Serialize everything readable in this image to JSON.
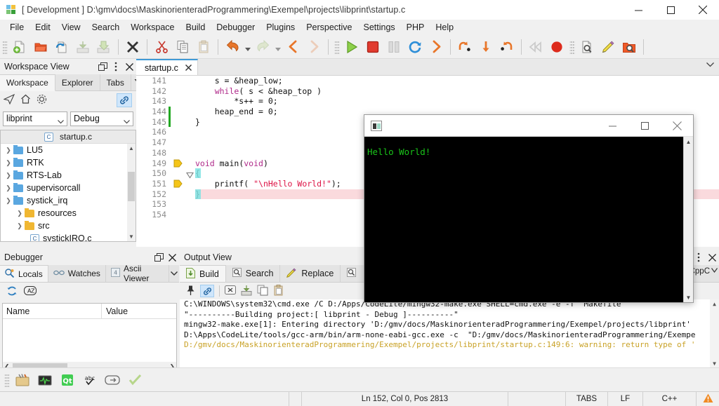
{
  "window": {
    "title": "[ Development ] D:\\gmv\\docs\\MaskinorienteradProgrammering\\Exempel\\projects\\libprint\\startup.c",
    "logo": "codelite-logo-icon",
    "controls": [
      {
        "name": "minimize-button",
        "glyph": "minimize-icon"
      },
      {
        "name": "maximize-button",
        "glyph": "maximize-icon"
      },
      {
        "name": "close-button",
        "glyph": "close-icon"
      }
    ]
  },
  "menubar": {
    "items": [
      "File",
      "Edit",
      "View",
      "Search",
      "Workspace",
      "Build",
      "Debugger",
      "Plugins",
      "Perspective",
      "Settings",
      "PHP",
      "Help"
    ]
  },
  "toolbar": {
    "groups": [
      {
        "buttons": [
          {
            "name": "new-file-button",
            "icon": "new-file-icon",
            "title": "New"
          },
          {
            "name": "open-file-button",
            "icon": "open-folder-icon",
            "title": "Open"
          },
          {
            "name": "reload-file-button",
            "icon": "reload-file-icon",
            "title": "Reload"
          },
          {
            "name": "save-file-button",
            "icon": "save-icon",
            "title": "Save",
            "disabled": true
          },
          {
            "name": "save-all-button",
            "icon": "save-all-icon",
            "title": "Save All",
            "disabled": true
          }
        ]
      },
      {
        "buttons": [
          {
            "name": "close-file-button",
            "icon": "close-x-icon",
            "title": "Close"
          }
        ]
      },
      {
        "buttons": [
          {
            "name": "cut-button",
            "icon": "scissors-icon",
            "title": "Cut"
          },
          {
            "name": "copy-button",
            "icon": "copy-icon",
            "title": "Copy"
          },
          {
            "name": "paste-button",
            "icon": "paste-icon",
            "title": "Paste",
            "disabled": true
          }
        ]
      },
      {
        "buttons": [
          {
            "name": "undo-button",
            "icon": "undo-arrow-icon",
            "title": "Undo",
            "dropdown": true
          },
          {
            "name": "redo-button",
            "icon": "redo-arrow-icon",
            "title": "Redo",
            "dropdown": true,
            "disabled": true
          },
          {
            "name": "back-button",
            "icon": "chevron-left-icon",
            "title": "Back"
          },
          {
            "name": "forward-button",
            "icon": "chevron-right-icon",
            "title": "Forward",
            "disabled": true
          }
        ]
      },
      {
        "buttons": [
          {
            "name": "start-debug-button",
            "icon": "play-triangle-icon",
            "title": "Start / Continue"
          },
          {
            "name": "stop-debug-button",
            "icon": "stop-square-icon",
            "title": "Stop"
          },
          {
            "name": "pause-debug-button",
            "icon": "pause-bars-icon",
            "title": "Pause",
            "disabled": true
          },
          {
            "name": "restart-debug-button",
            "icon": "restart-circular-arrow-icon",
            "title": "Restart"
          },
          {
            "name": "run-to-cursor-button",
            "icon": "chevron-right-orange-icon",
            "title": "Run to cursor"
          }
        ]
      },
      {
        "buttons": [
          {
            "name": "step-over-button",
            "icon": "step-over-icon",
            "title": "Step Over"
          },
          {
            "name": "step-into-button",
            "icon": "step-into-arrow-down-icon",
            "title": "Step Into"
          },
          {
            "name": "step-out-button",
            "icon": "step-out-icon",
            "title": "Step Out"
          }
        ]
      },
      {
        "buttons": [
          {
            "name": "rewind-button",
            "icon": "rewind-icon",
            "title": "Rewind",
            "disabled": true
          },
          {
            "name": "record-button",
            "icon": "record-circle-icon",
            "title": "Record"
          }
        ]
      },
      {
        "buttons": [
          {
            "name": "find-in-file-button",
            "icon": "find-document-icon",
            "title": "Find"
          },
          {
            "name": "replace-button",
            "icon": "pencil-icon",
            "title": "Replace"
          },
          {
            "name": "find-in-files-button",
            "icon": "find-in-files-icon",
            "title": "Find In Files"
          }
        ]
      }
    ]
  },
  "workspace_panel": {
    "title": "Workspace View",
    "head_tools": [
      {
        "name": "float-panel-button",
        "icon": "float-window-icon"
      },
      {
        "name": "panel-menu-button",
        "icon": "vertical-dots-icon"
      },
      {
        "name": "close-panel-button",
        "icon": "close-icon"
      }
    ],
    "tabs": [
      {
        "name": "tab-workspace",
        "label": "Workspace",
        "selected": true
      },
      {
        "name": "tab-explorer",
        "label": "Explorer",
        "selected": false
      },
      {
        "name": "tab-tabs",
        "label": "Tabs",
        "selected": false
      }
    ],
    "tabs_overflow_icon": "filter-funnel-icon",
    "tools": [
      {
        "name": "collapse-all-button",
        "icon": "paper-plane-icon"
      },
      {
        "name": "home-button",
        "icon": "home-icon"
      },
      {
        "name": "settings-button",
        "icon": "gear-icon"
      }
    ],
    "link_button": {
      "name": "link-editor-button",
      "icon": "link-chain-icon",
      "active": true
    },
    "selects": [
      {
        "name": "project-select",
        "value": "libprint"
      },
      {
        "name": "configuration-select",
        "value": "Debug"
      }
    ],
    "tree_header": {
      "name": "active-file-header",
      "label": "startup.c",
      "icon": "c-file-icon"
    },
    "tree": [
      {
        "label": "LU5",
        "icon": "folder-blue-icon",
        "expanded": false,
        "depth": 0
      },
      {
        "label": "RTK",
        "icon": "folder-blue-icon",
        "expanded": false,
        "depth": 0
      },
      {
        "label": "RTS-Lab",
        "icon": "folder-blue-icon",
        "expanded": false,
        "depth": 0
      },
      {
        "label": "supervisorcall",
        "icon": "folder-blue-icon",
        "expanded": false,
        "depth": 0
      },
      {
        "label": "systick_irq",
        "icon": "folder-blue-icon",
        "expanded": true,
        "depth": 0
      },
      {
        "label": "resources",
        "icon": "folder-yellow-icon",
        "expanded": false,
        "depth": 1
      },
      {
        "label": "src",
        "icon": "folder-yellow-icon",
        "expanded": true,
        "depth": 1
      },
      {
        "label": "systickIRQ.c",
        "icon": "c-file-icon",
        "expanded": null,
        "depth": 2
      }
    ]
  },
  "editor": {
    "tab": {
      "name": "editor-tab-startup-c",
      "label": "startup.c",
      "close_icon": "close-icon"
    },
    "overflow_icon": "chevron-down-icon",
    "first_line_number": 141,
    "lines": [
      {
        "n": 141,
        "text": "    s = &heap_low;",
        "marker": null,
        "highlight": false
      },
      {
        "n": 142,
        "text": "    while( s < &heap_top )",
        "marker": null,
        "highlight": false
      },
      {
        "n": 143,
        "text": "        *s++ = 0;",
        "marker": null,
        "highlight": false
      },
      {
        "n": 144,
        "text": "    heap_end = 0;",
        "marker": null,
        "highlight": false
      },
      {
        "n": 145,
        "text": "}",
        "marker": null,
        "highlight": false
      },
      {
        "n": 146,
        "text": "",
        "marker": null,
        "highlight": false
      },
      {
        "n": 147,
        "text": "",
        "marker": null,
        "highlight": false
      },
      {
        "n": 148,
        "text": "",
        "marker": null,
        "highlight": false
      },
      {
        "n": 149,
        "text": "void main(void)",
        "marker": "bookmark-arrow-icon",
        "highlight": false
      },
      {
        "n": 150,
        "text": "{",
        "marker": null,
        "highlight": false,
        "fold": true,
        "brace": true
      },
      {
        "n": 151,
        "text": "    printf( \"\\nHello World!\");",
        "marker": "bookmark-arrow-icon",
        "highlight": false
      },
      {
        "n": 152,
        "text": "}",
        "marker": null,
        "highlight": true,
        "brace": true
      },
      {
        "n": 153,
        "text": "",
        "marker": null,
        "highlight": false
      },
      {
        "n": 154,
        "text": "",
        "marker": null,
        "highlight": false
      }
    ]
  },
  "debugger_panel": {
    "title": "Debugger",
    "head_tools": [
      {
        "name": "float-panel-button",
        "icon": "float-window-icon"
      },
      {
        "name": "close-panel-button",
        "icon": "close-icon"
      }
    ],
    "tabs": [
      {
        "name": "tab-locals",
        "label": "Locals",
        "icon": "locals-icon",
        "selected": true
      },
      {
        "name": "tab-watches",
        "label": "Watches",
        "icon": "watches-glasses-icon",
        "selected": false
      },
      {
        "name": "tab-ascii-viewer",
        "label": "Ascii Viewer",
        "icon": "ascii-viewer-icon",
        "selected": false
      }
    ],
    "tabs_overflow_icon": "chevron-down-icon",
    "tools": [
      {
        "name": "refresh-button",
        "icon": "refresh-arrows-icon"
      },
      {
        "name": "sort-button",
        "icon": "az-sort-icon"
      }
    ],
    "columns": [
      "Name",
      "Value"
    ],
    "rows": []
  },
  "output_panel": {
    "title": "Output View",
    "head_tools": [
      {
        "name": "float-panel-button",
        "icon": "float-window-icon"
      },
      {
        "name": "panel-menu-button",
        "icon": "vertical-dots-icon"
      },
      {
        "name": "close-panel-button",
        "icon": "close-icon"
      }
    ],
    "tabs": [
      {
        "name": "tab-build",
        "label": "Build",
        "icon": "build-page-icon",
        "selected": true
      },
      {
        "name": "tab-search",
        "label": "Search",
        "icon": "search-magnifier-icon",
        "selected": false
      },
      {
        "name": "tab-replace",
        "label": "Replace",
        "icon": "pencil-icon",
        "selected": false
      },
      {
        "name": "tab-references",
        "label": "",
        "icon": "search-magnifier-icon",
        "selected": false
      }
    ],
    "tools": [
      {
        "name": "pin-button",
        "icon": "pin-icon"
      },
      {
        "name": "link-button",
        "icon": "link-chain-icon",
        "active": true
      },
      {
        "name": "clear-button",
        "icon": "clear-x-icon"
      },
      {
        "name": "save-output-button",
        "icon": "save-icon"
      },
      {
        "name": "copy-output-button",
        "icon": "copy-icon"
      },
      {
        "name": "paste-output-button",
        "icon": "paste-icon"
      }
    ],
    "lines": [
      {
        "text": "C:\\WINDOWS\\system32\\cmd.exe /C D:/Apps/CodeLite/mingw32-make.exe SHELL=cmd.exe -e -f  Makefile",
        "style": "normal"
      },
      {
        "text": "\"----------Building project:[ libprint - Debug ]----------\"",
        "style": "normal"
      },
      {
        "text": "mingw32-make.exe[1]: Entering directory 'D:/gmv/docs/MaskinorienteradProgrammering/Exempel/projects/libprint'",
        "style": "normal"
      },
      {
        "text": "D:\\Apps\\CodeLite/tools/gcc-arm/bin/arm-none-eabi-gcc.exe -c  \"D:/gmv/docs/MaskinorienteradProgrammering/Exempe",
        "style": "normal"
      },
      {
        "text": "D:/gmv/docs/MaskinorienteradProgrammering/Exempel/projects/libprint/startup.c:149:6: warning: return type of '",
        "style": "warn"
      }
    ],
    "side_tab": {
      "name": "cppcheck-tab",
      "label": "CppC",
      "icon": "chevron-icon"
    }
  },
  "bottom_toolbar": {
    "buttons": [
      {
        "name": "build-tools-button",
        "icon": "toolbox-icon"
      },
      {
        "name": "monitor-button",
        "icon": "monitor-graph-icon"
      },
      {
        "name": "qt-button",
        "icon": "qt-logo-icon"
      },
      {
        "name": "spellcheck-button",
        "icon": "abc-check-icon"
      },
      {
        "name": "wrap-button",
        "icon": "wrap-arrow-icon"
      },
      {
        "name": "confirm-button",
        "icon": "green-check-icon"
      }
    ]
  },
  "statusbar": {
    "cells": [
      {
        "name": "status-empty-1",
        "label": ""
      },
      {
        "name": "status-empty-2",
        "label": ""
      },
      {
        "name": "status-position",
        "label": "Ln 152, Col 0, Pos 2813"
      },
      {
        "name": "status-empty-3",
        "label": ""
      },
      {
        "name": "status-tabs",
        "label": "TABS"
      },
      {
        "name": "status-eol",
        "label": "LF"
      },
      {
        "name": "status-language",
        "label": "C++"
      },
      {
        "name": "status-warning",
        "label": "",
        "icon": "warning-triangle-icon"
      }
    ]
  },
  "console_window": {
    "title": "",
    "icon": "console-app-icon",
    "controls": [
      {
        "name": "console-minimize-button",
        "glyph": "minimize-icon"
      },
      {
        "name": "console-maximize-button",
        "glyph": "maximize-icon"
      },
      {
        "name": "console-close-button",
        "glyph": "close-icon"
      }
    ],
    "output_text": "Hello World!",
    "scrollbar": {
      "name": "console-scrollbar",
      "up_icon": "chevron-up-icon",
      "down_icon": "chevron-down-icon"
    }
  },
  "colors": {
    "accent_blue": "#3f9ad6",
    "console_green": "#19c419",
    "highlight_pink": "#fadadd",
    "brace_cyan": "#7fe3e3",
    "warning_yellow": "#c9a227",
    "folder_blue": "#5aa7e0",
    "folder_yellow": "#f0b732"
  }
}
